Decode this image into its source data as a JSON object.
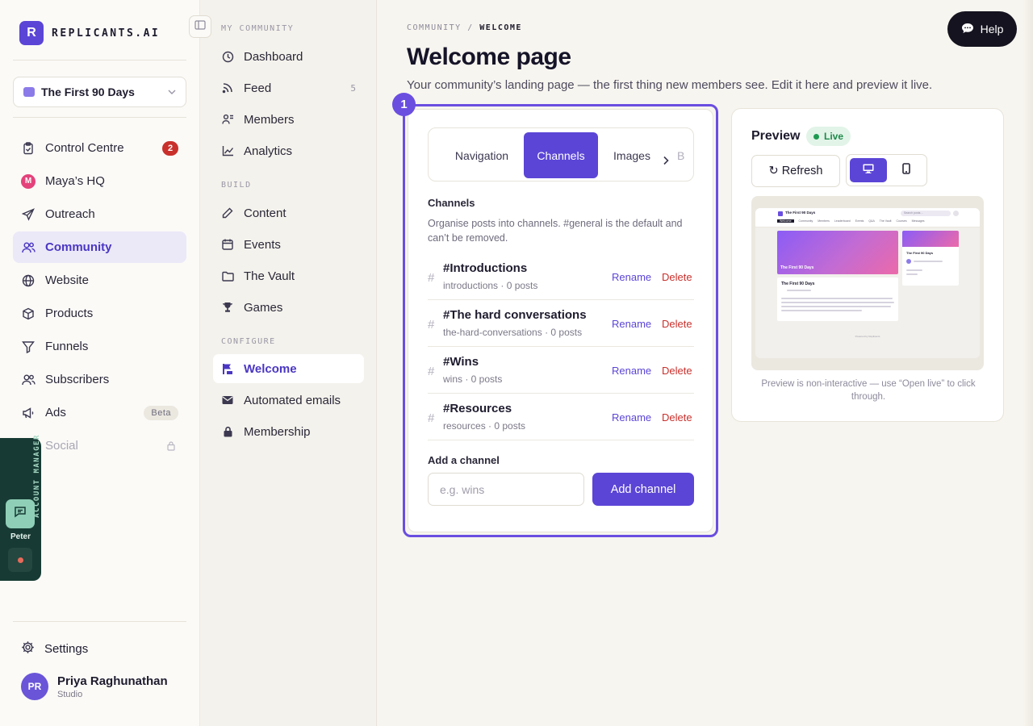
{
  "brand": {
    "mark": "R",
    "name": "REPLICANTS.AI"
  },
  "workspace": {
    "name": "The First 90 Days"
  },
  "nav": {
    "items": [
      {
        "label": "Control Centre",
        "badge": "2"
      },
      {
        "label": "Maya’s HQ",
        "mark": "M"
      },
      {
        "label": "Outreach"
      },
      {
        "label": "Community"
      },
      {
        "label": "Website"
      },
      {
        "label": "Products"
      },
      {
        "label": "Funnels"
      },
      {
        "label": "Subscribers"
      },
      {
        "label": "Ads",
        "badge": "Beta"
      },
      {
        "label": "Social"
      }
    ]
  },
  "account_manager": {
    "label": "ACCOUNT MANAGER",
    "name": "Peter"
  },
  "footer": {
    "settings_label": "Settings"
  },
  "user": {
    "initials": "PR",
    "name": "Priya Raghunathan",
    "role": "Studio"
  },
  "subnav": {
    "sections": [
      {
        "heading": "MY COMMUNITY",
        "items": [
          {
            "label": "Dashboard"
          },
          {
            "label": "Feed",
            "count": "5"
          },
          {
            "label": "Members"
          },
          {
            "label": "Analytics"
          }
        ]
      },
      {
        "heading": "BUILD",
        "items": [
          {
            "label": "Content"
          },
          {
            "label": "Events"
          },
          {
            "label": "The Vault"
          },
          {
            "label": "Games"
          }
        ]
      },
      {
        "heading": "CONFIGURE",
        "items": [
          {
            "label": "Welcome"
          },
          {
            "label": "Automated emails"
          },
          {
            "label": "Membership"
          }
        ]
      }
    ]
  },
  "breadcrumb": {
    "parent": "COMMUNITY",
    "separator": "/",
    "current": "WELCOME"
  },
  "page": {
    "title": "Welcome page",
    "subtitle": "Your community’s landing page — the first thing new members see. Edit it here and preview it live."
  },
  "help": {
    "label": "Help"
  },
  "step": {
    "number": "1"
  },
  "editor": {
    "tabs": [
      {
        "label": "Navigation"
      },
      {
        "label": "Channels",
        "active": true
      },
      {
        "label": "Images"
      },
      {
        "label": "B"
      }
    ],
    "section_title": "Channels",
    "section_help": "Organise posts into channels. #general is the default and can’t be removed.",
    "channels": [
      {
        "name": "#Introductions",
        "meta": "introductions · 0 posts"
      },
      {
        "name": "#The hard conversations",
        "meta": "the-hard-conversations · 0 posts"
      },
      {
        "name": "#Wins",
        "meta": "wins · 0 posts"
      },
      {
        "name": "#Resources",
        "meta": "resources · 0 posts"
      }
    ],
    "hash_symbol": "#",
    "rename_label": "Rename",
    "delete_label": "Delete",
    "add_title": "Add a channel",
    "add_placeholder": "e.g. wins",
    "add_value": "",
    "add_button": "Add channel"
  },
  "preview": {
    "title": "Preview",
    "live_label": "Live",
    "refresh_label": "↻ Refresh",
    "note": "Preview is non-interactive — use “Open live” to click through.",
    "mini": {
      "site_name": "The First 90 Days",
      "search": "Search posts…",
      "tabs": [
        "Welcome",
        "Community",
        "Members",
        "Leaderboard",
        "Events",
        "Q&A",
        "The Vault",
        "Courses",
        "Messages"
      ],
      "hero_text": "The First 90 Days",
      "card_title": "The First 90 Days",
      "side_title": "The First 90 Days",
      "powered": "Powered by Replicants"
    }
  },
  "colors": {
    "accent": "#5b45d6",
    "danger": "#c9302c",
    "live": "#1f8a4a",
    "account_manager_bg": "#173b34"
  }
}
